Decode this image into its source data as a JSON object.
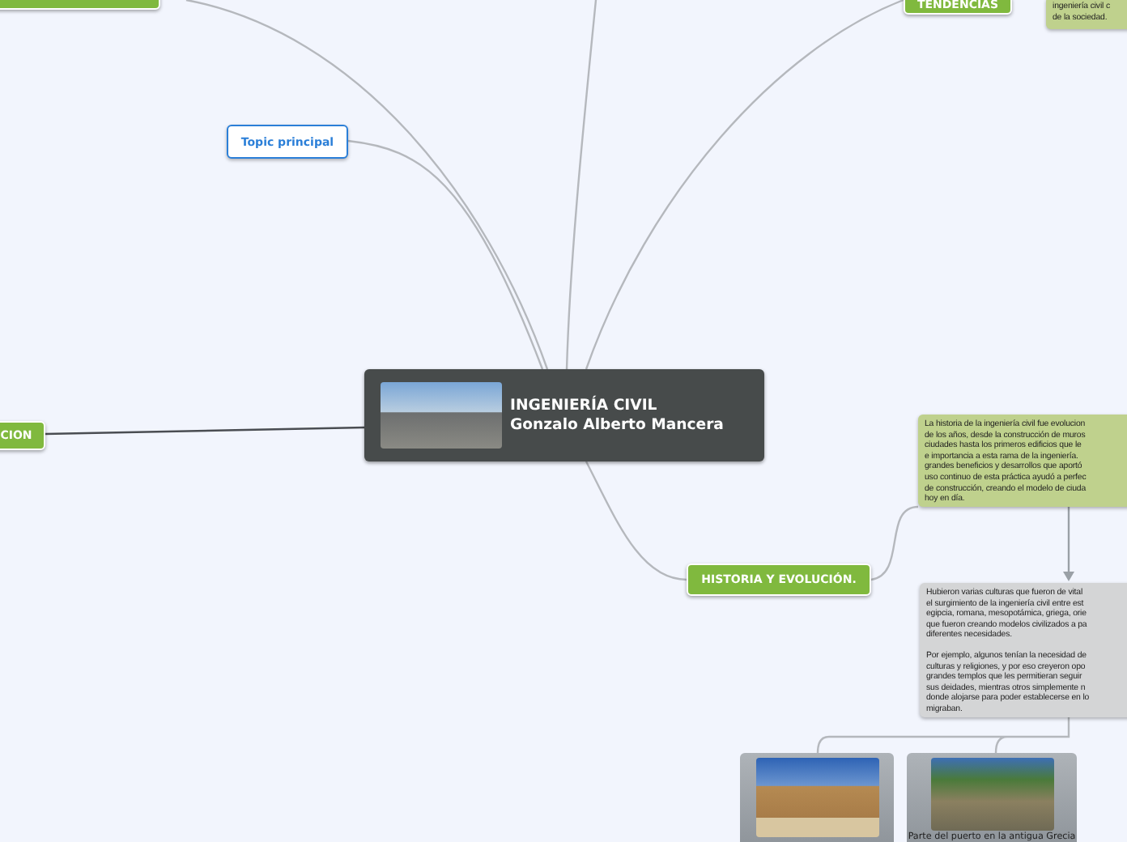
{
  "central_topic": {
    "title": "INGENIERÍA CIVIL",
    "subtitle": "Gonzalo Alberto Mancera"
  },
  "nodes": [
    {
      "kind": "main"
    },
    {
      "kind": "main",
      "label": "TENDENCIAS"
    },
    {
      "kind": "note",
      "paragraphs": [
        "ingeniería civil c\nde la sociedad."
      ]
    },
    {
      "kind": "subtopic",
      "label": "Topic principal"
    },
    {
      "kind": "main",
      "label": "CION"
    },
    {
      "kind": "main",
      "label": "HISTORIA Y EVOLUCIÓN."
    },
    {
      "kind": "note",
      "paragraphs": [
        "La historia de la ingeniería civil fue evolucion\nde los años, desde la construcción de muros\nciudades hasta los primeros edificios que le\ne importancia a esta rama de la ingeniería.\ngrandes beneficios y desarrollos que aportó\nuso continuo de esta práctica ayudó a perfec\nde construcción, creando el modelo de ciuda\nhoy en día."
      ]
    },
    {
      "kind": "grey_note",
      "paragraphs": [
        "Hubieron varias culturas que fueron de vital\nel surgimiento de la ingeniería civil entre est\negipcia, romana, mesopotámica, griega, orie\nque fueron creando modelos civilizados a pa\ndiferentes necesidades.",
        "Por ejemplo, algunos tenían la necesidad de\nculturas y religiones, y por eso creyeron opo\ngrandes templos que les permitieran seguir\nsus deidades, mientras otros simplemente n\ndonde alojarse para poder establecerse en lo\nmigraban."
      ]
    },
    {
      "kind": "image_card"
    },
    {
      "kind": "image_card",
      "caption": "Parte del puerto en la antigua Grecia"
    }
  ]
}
